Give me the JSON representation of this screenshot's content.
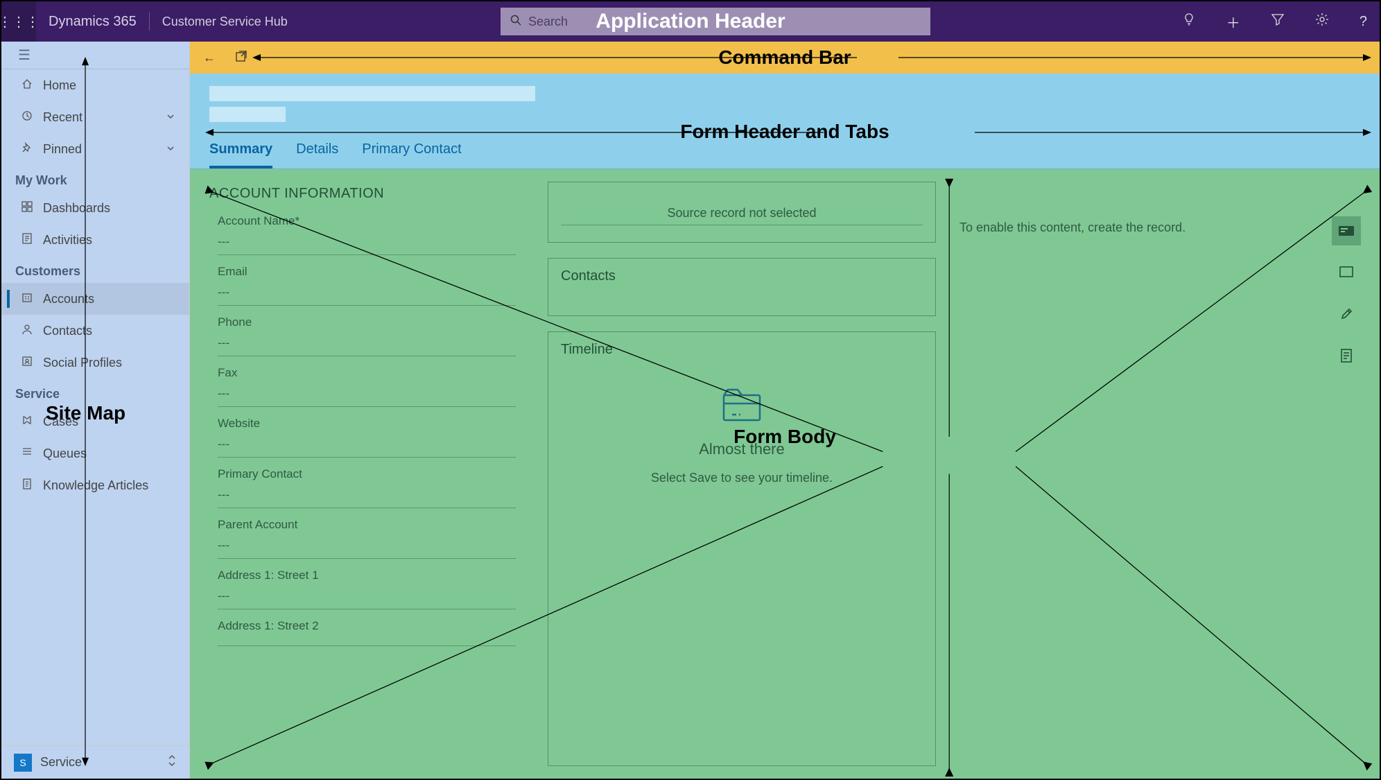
{
  "annotations": {
    "app_header": "Application Header",
    "command_bar": "Command Bar",
    "form_header": "Form Header and Tabs",
    "site_map": "Site Map",
    "form_body": "Form Body"
  },
  "header": {
    "brand": "Dynamics 365",
    "app_name": "Customer Service Hub",
    "search_placeholder": "Search"
  },
  "sidebar": {
    "top": [
      {
        "icon": "home",
        "label": "Home"
      },
      {
        "icon": "clock",
        "label": "Recent",
        "chevron": true
      },
      {
        "icon": "pin",
        "label": "Pinned",
        "chevron": true
      }
    ],
    "groups": [
      {
        "title": "My Work",
        "items": [
          {
            "icon": "dash",
            "label": "Dashboards"
          },
          {
            "icon": "act",
            "label": "Activities"
          }
        ]
      },
      {
        "title": "Customers",
        "items": [
          {
            "icon": "acct",
            "label": "Accounts",
            "active": true
          },
          {
            "icon": "person",
            "label": "Contacts"
          },
          {
            "icon": "social",
            "label": "Social Profiles"
          }
        ]
      },
      {
        "title": "Service",
        "items": [
          {
            "icon": "case",
            "label": "Cases"
          },
          {
            "icon": "queue",
            "label": "Queues"
          },
          {
            "icon": "ka",
            "label": "Knowledge Articles"
          }
        ]
      }
    ],
    "area_badge": "S",
    "area": "Service"
  },
  "form": {
    "tabs": [
      "Summary",
      "Details",
      "Primary Contact"
    ],
    "active_tab": "Summary",
    "section_title": "ACCOUNT INFORMATION",
    "fields": [
      {
        "label": "Account Name*",
        "value": "---"
      },
      {
        "label": "Email",
        "value": "---"
      },
      {
        "label": "Phone",
        "value": "---"
      },
      {
        "label": "Fax",
        "value": "---"
      },
      {
        "label": "Website",
        "value": "---"
      },
      {
        "label": "Primary Contact",
        "value": "---"
      },
      {
        "label": "Parent Account",
        "value": "---"
      },
      {
        "label": "Address 1: Street 1",
        "value": "---"
      },
      {
        "label": "Address 1: Street 2",
        "value": ""
      }
    ],
    "source_empty": "Source record not selected",
    "contacts_title": "Contacts",
    "timeline_title": "Timeline",
    "timeline_heading": "Almost there",
    "timeline_sub": "Select Save to see your timeline.",
    "col3_msg": "To enable this content, create the record."
  }
}
